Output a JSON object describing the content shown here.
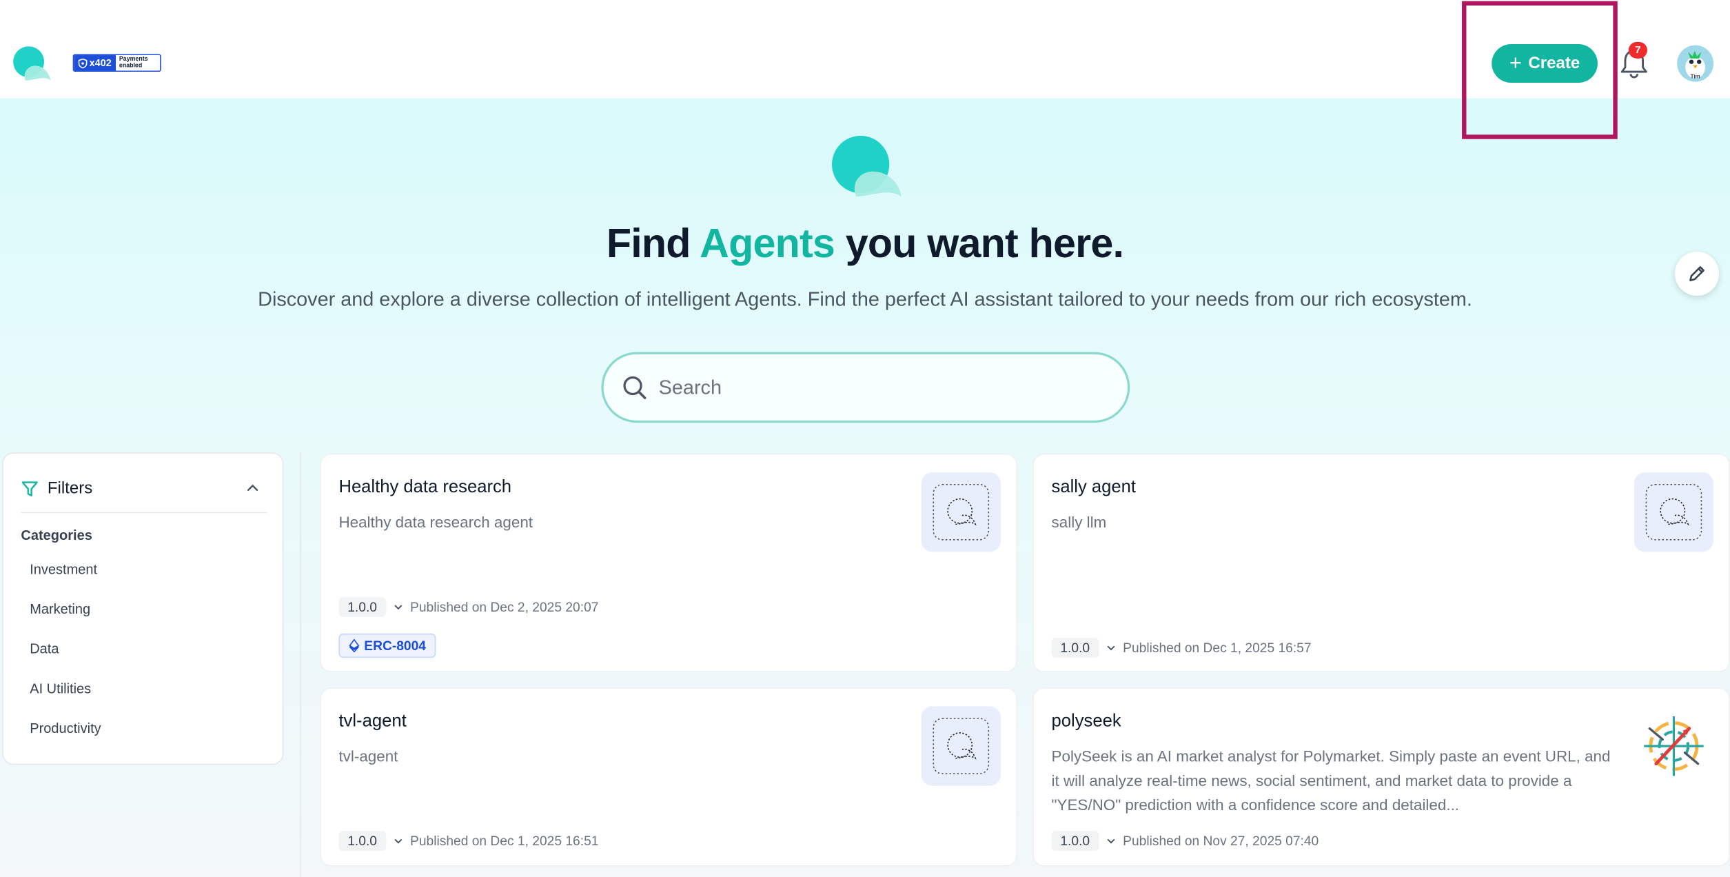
{
  "header": {
    "badge_primary": "x402",
    "badge_secondary_line1": "Payments",
    "badge_secondary_line2": "enabled",
    "create_label": "Create",
    "notification_count": "7",
    "avatar_label": "Tim"
  },
  "hero": {
    "title_prefix": "Find ",
    "title_accent": "Agents",
    "title_suffix": " you want here.",
    "subtitle": "Discover and explore a diverse collection of intelligent Agents. Find the perfect AI assistant tailored to your needs from our rich ecosystem."
  },
  "search": {
    "placeholder": "Search",
    "value": ""
  },
  "filters": {
    "title": "Filters",
    "categories_label": "Categories",
    "categories": [
      "Investment",
      "Marketing",
      "Data",
      "AI Utilities",
      "Productivity"
    ]
  },
  "agents": [
    {
      "title": "Healthy data research",
      "description": "Healthy data research agent",
      "version": "1.0.0",
      "published": "Published on Dec 2, 2025 20:07",
      "tag": "ERC-8004"
    },
    {
      "title": "sally agent",
      "description": "sally llm",
      "version": "1.0.0",
      "published": "Published on Dec 1, 2025 16:57"
    },
    {
      "title": "tvl-agent",
      "description": "tvl-agent",
      "version": "1.0.0",
      "published": "Published on Dec 1, 2025 16:51"
    },
    {
      "title": "polyseek",
      "description": "PolySeek is an AI market analyst for Polymarket. Simply paste an event URL, and it will analyze real-time news, social sentiment, and market data to provide a \"YES/NO\" prediction with a confidence score and detailed...",
      "version": "1.0.0",
      "published": "Published on Nov 27, 2025 07:40"
    }
  ],
  "colors": {
    "accent": "#12b5a0",
    "highlight": "#b0165f",
    "badge_red": "#ef2b2b",
    "x402_blue": "#1d4ed8"
  }
}
